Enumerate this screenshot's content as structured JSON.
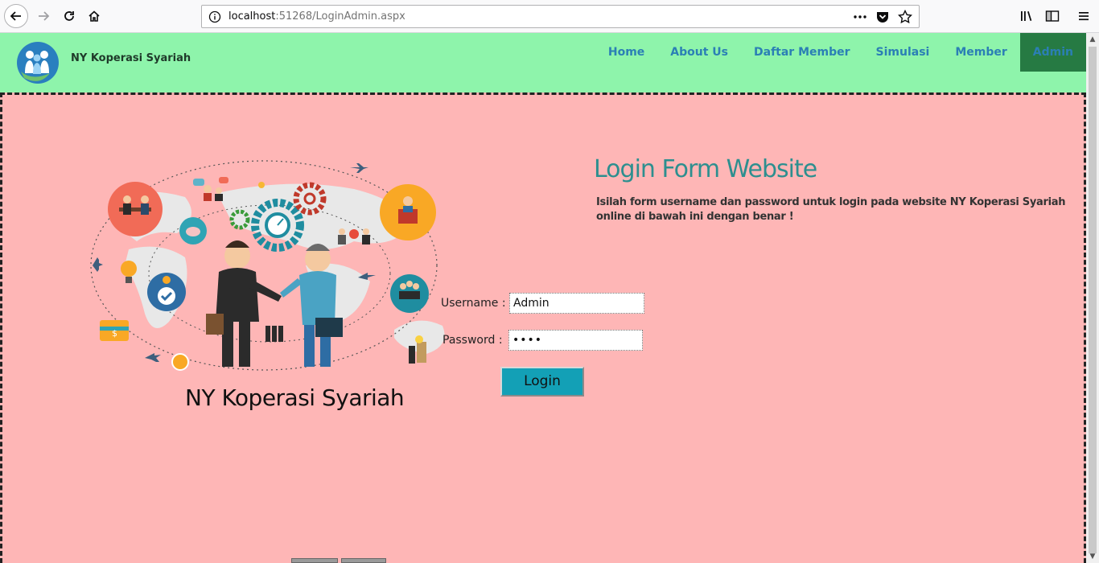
{
  "browser": {
    "url_host": "localhost",
    "url_rest": ":51268/LoginAdmin.aspx",
    "icons": [
      "back-icon",
      "forward-icon",
      "reload-icon",
      "home-icon",
      "info-icon",
      "more-icon",
      "pocket-icon",
      "bookmark-star-icon",
      "library-icon",
      "sidebar-icon",
      "menu-icon"
    ]
  },
  "header": {
    "brand": "NY Koperasi Syariah",
    "nav": [
      {
        "label": "Home"
      },
      {
        "label": "About Us"
      },
      {
        "label": "Daftar Member"
      },
      {
        "label": "Simulasi"
      },
      {
        "label": "Member"
      },
      {
        "label": "Admin",
        "active": true
      }
    ]
  },
  "illustration": {
    "caption": "NY Koperasi Syariah"
  },
  "login": {
    "title": "Login Form Website",
    "description": "Isilah form username dan password untuk login pada website NY Koperasi Syariah online di bawah ini dengan benar !",
    "username_label": "Username :",
    "username_value": "Admin",
    "password_label": "Password :",
    "password_value": "••••",
    "button_label": "Login"
  },
  "colors": {
    "header_bg": "#8ef4ab",
    "main_bg": "#feb6b6",
    "nav_link": "#2b7fb5",
    "nav_active_bg": "#267a43",
    "title": "#2d8f8f",
    "button": "#13a0b6"
  }
}
